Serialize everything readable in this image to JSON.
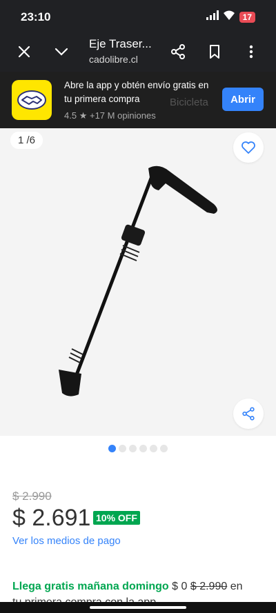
{
  "status": {
    "time": "23:10",
    "battery": "17"
  },
  "toolbar": {
    "title": "Eje Traser...",
    "url": "cadolibre.cl"
  },
  "banner": {
    "promo": "Abre la app y obtén envío gratis en tu primera compra",
    "rating": "4.5",
    "reviews": "+17 M opiniones",
    "ghost_text": "Bicicleta",
    "open_label": "Abrir"
  },
  "gallery": {
    "counter": "1 /6",
    "active_index": 0,
    "total": 6
  },
  "pricing": {
    "old_price": "$ 2.990",
    "price": "$ 2.691",
    "discount": "10% OFF",
    "payment_link": "Ver los medios de pago"
  },
  "shipping": {
    "highlight": "Llega gratis mañana domingo",
    "cost": "$ 0",
    "old_cost": "$ 2.990",
    "suffix": "en",
    "line2": "tu primera compra con la app"
  },
  "colors": {
    "accent": "#3483fa",
    "green": "#00a650",
    "brand_yellow": "#ffe600"
  }
}
